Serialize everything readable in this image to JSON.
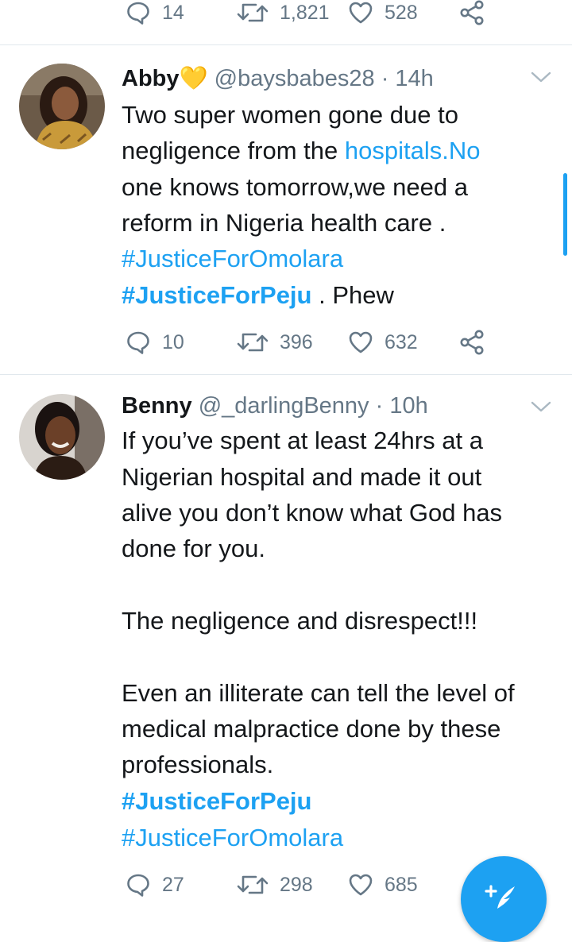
{
  "top_actions": {
    "replies": "14",
    "retweets": "1,821",
    "likes": "528"
  },
  "tweets": [
    {
      "name": "Abby",
      "badge": "💛",
      "handle": "@baysbabes28",
      "time": "· 14h",
      "lines": [
        {
          "parts": [
            {
              "t": "Two super women gone due to",
              "s": "text"
            }
          ]
        },
        {
          "parts": [
            {
              "t": "negligence from the ",
              "s": "text"
            },
            {
              "t": "hospitals.No",
              "s": "link"
            }
          ]
        },
        {
          "parts": [
            {
              "t": "one knows tomorrow,we need a",
              "s": "text"
            }
          ]
        },
        {
          "parts": [
            {
              "t": "reform in Nigeria health care .",
              "s": "text"
            }
          ]
        },
        {
          "parts": [
            {
              "t": "#JusticeForOmolara",
              "s": "link"
            }
          ]
        },
        {
          "parts": [
            {
              "t": "#JusticeForPeju",
              "s": "bold-link"
            },
            {
              "t": " . Phew",
              "s": "text"
            }
          ]
        }
      ],
      "replies": "10",
      "retweets": "396",
      "likes": "632"
    },
    {
      "name": "Benny",
      "handle": "@_darlingBenny",
      "time": "· 10h",
      "lines": [
        {
          "parts": [
            {
              "t": "If you’ve spent at least 24hrs at a",
              "s": "text"
            }
          ]
        },
        {
          "parts": [
            {
              "t": "Nigerian hospital and made it out",
              "s": "text"
            }
          ]
        },
        {
          "parts": [
            {
              "t": "alive you don’t know what God has",
              "s": "text"
            }
          ]
        },
        {
          "parts": [
            {
              "t": "done for you.",
              "s": "text"
            }
          ]
        },
        {
          "parts": [
            {
              "t": "The negligence and disrespect!!!",
              "s": "text"
            }
          ]
        },
        {
          "parts": [
            {
              "t": "Even an illiterate can tell the level of",
              "s": "text"
            }
          ]
        },
        {
          "parts": [
            {
              "t": "medical malpractice done by these",
              "s": "text"
            }
          ]
        },
        {
          "parts": [
            {
              "t": "professionals.",
              "s": "text"
            }
          ]
        },
        {
          "parts": [
            {
              "t": "#JusticeForPeju",
              "s": "bold-link"
            }
          ]
        },
        {
          "parts": [
            {
              "t": "#JusticeForOmolara",
              "s": "link"
            }
          ]
        }
      ],
      "replies": "27",
      "retweets": "298",
      "likes": "685"
    }
  ],
  "colors": {
    "accent": "#1da1f2",
    "muted": "#657786",
    "text": "#14171a",
    "divider": "#e1e8ed"
  },
  "icons": [
    "reply-icon",
    "retweet-icon",
    "like-icon",
    "share-icon",
    "chevron-down-icon",
    "compose-icon"
  ]
}
